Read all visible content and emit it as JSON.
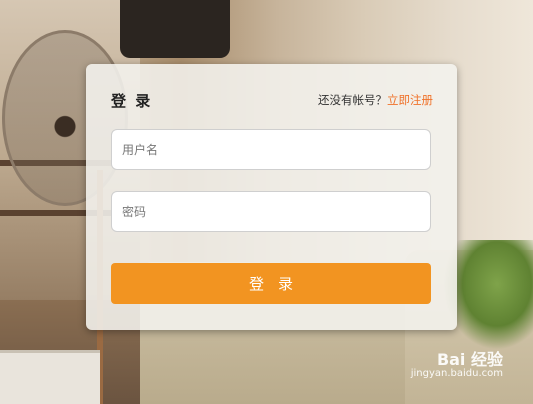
{
  "login": {
    "title": "登 录",
    "register_prompt": "还没有帐号？",
    "register_link": "立即注册",
    "username_placeholder": "用户名",
    "password_placeholder": "密码",
    "submit_label": "登录"
  },
  "watermark": {
    "logo_text": "Bai 经验",
    "url": "jingyan.baidu.com"
  },
  "colors": {
    "accent": "#f29421",
    "link": "#f0722a",
    "card_bg": "#f4f2ee"
  }
}
